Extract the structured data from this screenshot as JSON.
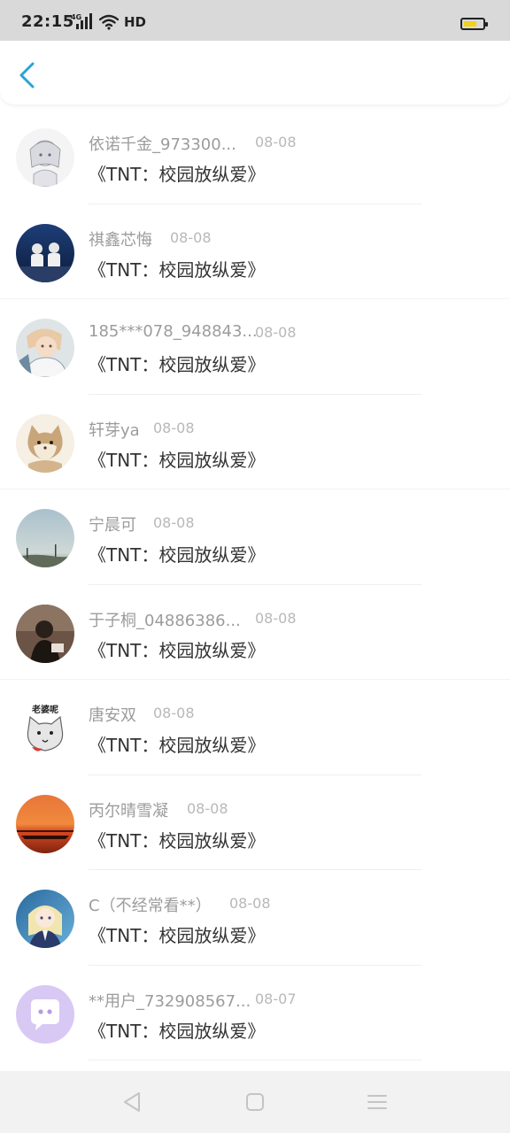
{
  "status_bar": {
    "time": "22:15",
    "signal_tag": "4G",
    "hd": "HD",
    "battery_level": 0.7,
    "battery_color": "#f1d21b"
  },
  "header": {
    "back_icon": "chevron-left-icon",
    "accent_color": "#2aa3d8"
  },
  "items": [
    {
      "name": "依诺千金_973300...",
      "date": "08-08",
      "title": "《TNT：校园放纵爱》",
      "avatar": "anime-girl"
    },
    {
      "name": "祺鑫芯悔",
      "date": "08-08",
      "title": "《TNT：校园放纵爱》",
      "avatar": "two-figures-blue"
    },
    {
      "name": "185***078_948843...",
      "date": "08-08",
      "title": "《TNT：校园放纵爱》",
      "avatar": "anime-boy"
    },
    {
      "name": "轩芽ya",
      "date": "08-08",
      "title": "《TNT：校园放纵爱》",
      "avatar": "fluffy-cat"
    },
    {
      "name": "宁晨可",
      "date": "08-08",
      "title": "《TNT：校园放纵爱》",
      "avatar": "sky-landscape"
    },
    {
      "name": "于子桐_04886386...",
      "date": "08-08",
      "title": "《TNT：校园放纵爱》",
      "avatar": "dark-portrait"
    },
    {
      "name": "唐安双",
      "date": "08-08",
      "title": "《TNT：校园放纵爱》",
      "avatar": "cat-sticker",
      "avatar_text": "老婆呢"
    },
    {
      "name": "丙尔晴雪凝",
      "date": "08-08",
      "title": "《TNT：校园放纵爱》",
      "avatar": "sunset"
    },
    {
      "name": "C（不经常看**）",
      "date": "08-08",
      "title": "《TNT：校园放纵爱》",
      "avatar": "anime-idol"
    },
    {
      "name": "**用户_732908567...",
      "date": "08-07",
      "title": "《TNT：校园放纵爱》",
      "avatar": "chat-bubble-purple"
    }
  ],
  "nav_bar": {
    "back_icon": "triangle-back-icon",
    "home_icon": "square-home-icon",
    "menu_icon": "three-lines-menu-icon"
  }
}
